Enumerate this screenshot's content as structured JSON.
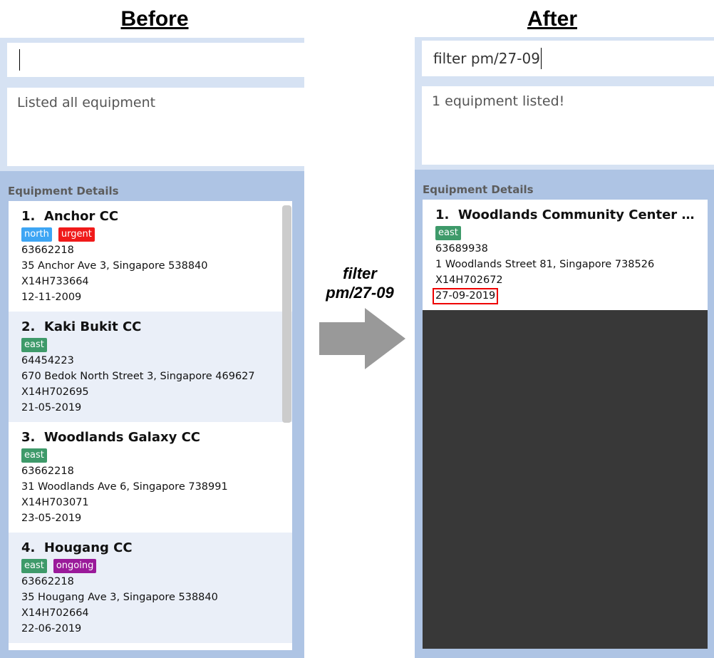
{
  "before": {
    "title": "Before",
    "command_value": "",
    "result": "Listed all equipment",
    "panel_label": "Equipment Details",
    "items": [
      {
        "index": "1.",
        "name": "Anchor CC",
        "tags": [
          {
            "label": "north",
            "color": "#3da5f4"
          },
          {
            "label": "urgent",
            "color": "#f01a1a"
          }
        ],
        "phone": "63662218",
        "address": "35 Anchor Ave 3, Singapore 538840",
        "serial": "X14H733664",
        "date": "12-11-2009"
      },
      {
        "index": "2.",
        "name": "Kaki Bukit CC",
        "tags": [
          {
            "label": "east",
            "color": "#3e9a6a"
          }
        ],
        "phone": "64454223",
        "address": "670 Bedok North Street 3, Singapore 469627",
        "serial": "X14H702695",
        "date": "21-05-2019"
      },
      {
        "index": "3.",
        "name": "Woodlands Galaxy CC",
        "tags": [
          {
            "label": "east",
            "color": "#3e9a6a"
          }
        ],
        "phone": "63662218",
        "address": "31 Woodlands Ave 6, Singapore 738991",
        "serial": "X14H703071",
        "date": "23-05-2019"
      },
      {
        "index": "4.",
        "name": "Hougang CC",
        "tags": [
          {
            "label": "east",
            "color": "#3e9a6a"
          },
          {
            "label": "ongoing",
            "color": "#9a1a9a"
          }
        ],
        "phone": "63662218",
        "address": "35 Hougang Ave 3, Singapore 538840",
        "serial": "X14H702664",
        "date": "22-06-2019"
      }
    ]
  },
  "arrow": {
    "line1": "filter",
    "line2": "pm/27-09"
  },
  "after": {
    "title": "After",
    "command_value": "filter pm/27-09",
    "result": "1 equipment listed!",
    "panel_label": "Equipment Details",
    "items": [
      {
        "index": "1.",
        "name": "Woodlands Community Center Singapore",
        "tags": [
          {
            "label": "east",
            "color": "#3e9a6a"
          }
        ],
        "phone": "63689938",
        "address": "1 Woodlands Street 81, Singapore 738526",
        "serial": "X14H702672",
        "date": "27-09-2019"
      }
    ]
  }
}
